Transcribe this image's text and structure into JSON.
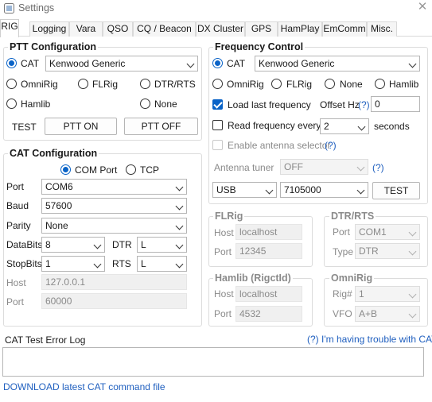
{
  "window": {
    "title": "Settings",
    "close_glyph": "✕",
    "icon": "settings-app-icon"
  },
  "tabs": [
    "RIG",
    "Logging",
    "Vara",
    "QSO",
    "CQ / Beacon",
    "DX Cluster",
    "GPS",
    "HamPlay",
    "EmComm",
    "Misc."
  ],
  "active_tab": "RIG",
  "ptt": {
    "title": "PTT Configuration",
    "cat_label": "CAT",
    "cat_select": "Kenwood Generic",
    "omnirig": "OmniRig",
    "flrig": "FLRig",
    "dtr_rts": "DTR/RTS",
    "hamlib": "Hamlib",
    "none": "None",
    "test_label": "TEST",
    "ptt_on": "PTT ON",
    "ptt_off": "PTT OFF",
    "selected": "CAT"
  },
  "cat": {
    "title": "CAT Configuration",
    "com_port": "COM Port",
    "tcp": "TCP",
    "selected": "COM Port",
    "port_label": "Port",
    "port_value": "COM6",
    "baud_label": "Baud",
    "baud_value": "57600",
    "parity_label": "Parity",
    "parity_value": "None",
    "databits_label": "DataBits",
    "databits_value": "8",
    "dtr_label": "DTR",
    "dtr_value": "L",
    "stopbits_label": "StopBits",
    "stopbits_value": "1",
    "rts_label": "RTS",
    "rts_value": "L",
    "host_label": "Host",
    "host_value": "127.0.0.1",
    "tcp_port_label": "Port",
    "tcp_port_value": "60000"
  },
  "freq": {
    "title": "Frequency Control",
    "cat_label": "CAT",
    "cat_select": "Kenwood Generic",
    "omnirig": "OmniRig",
    "flrig": "FLRig",
    "none": "None",
    "hamlib": "Hamlib",
    "selected": "CAT",
    "load_last": "Load last frequency",
    "load_last_checked": true,
    "offset_label": "Offset Hz",
    "help": "(?)",
    "offset_value": "0",
    "read_every": "Read frequency every",
    "read_every_checked": false,
    "read_every_value": "2",
    "seconds": "seconds",
    "enable_antenna": "Enable antenna selector",
    "antenna_tuner_label": "Antenna tuner",
    "antenna_tuner_value": "OFF",
    "mode_value": "USB",
    "frequency_value": "7105000",
    "test_button": "TEST"
  },
  "flrig": {
    "title": "FLRig",
    "host_label": "Host",
    "host_value": "localhost",
    "port_label": "Port",
    "port_value": "12345"
  },
  "dtr_rts": {
    "title": "DTR/RTS",
    "port_label": "Port",
    "port_value": "COM1",
    "type_label": "Type",
    "type_value": "DTR"
  },
  "hamlib": {
    "title": "Hamlib (RigctId)",
    "host_label": "Host",
    "host_value": "localhost",
    "port_label": "Port",
    "port_value": "4532"
  },
  "omnirig": {
    "title": "OmniRig",
    "rig_label": "Rig#",
    "rig_value": "1",
    "vfo_label": "VFO",
    "vfo_value": "A+B"
  },
  "log": {
    "title": "CAT Test Error Log",
    "help_link": "(?) I'm having trouble with CAT",
    "download_link": "DOWNLOAD latest CAT command file"
  },
  "colors": {
    "accent": "#0a63c7",
    "link": "#1f5fbf",
    "border": "#dcdcdc"
  }
}
